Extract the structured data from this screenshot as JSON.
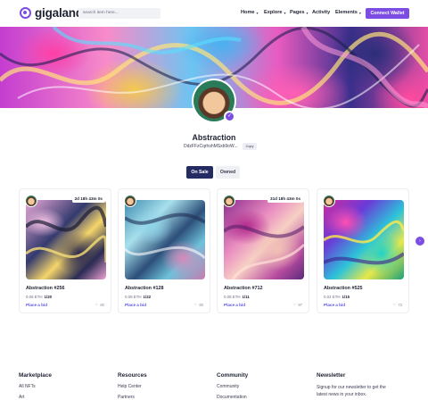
{
  "header": {
    "logo_text": "gigaland",
    "search_placeholder": "search item here...",
    "nav": [
      {
        "label": "Home",
        "caret": "▾"
      },
      {
        "label": "Explore",
        "caret": "▾"
      },
      {
        "label": "Pages",
        "caret": "▾"
      },
      {
        "label": "Activity",
        "caret": ""
      },
      {
        "label": "Elements",
        "caret": "▾"
      }
    ],
    "connect_label": "Connect Wallet"
  },
  "profile": {
    "name": "Abstraction",
    "wallet": "DdzFFzCqrhshMSxb9oW...",
    "copy_label": "Copy",
    "verified_glyph": "✓"
  },
  "tabs": {
    "on_sale": "On Sale",
    "owned": "Owned"
  },
  "cards": [
    {
      "title": "Abstraction #256",
      "price_label": "0.06 ETH",
      "count": "1/20",
      "bid": "Place a bid",
      "likes": "80",
      "countdown": "2d  18h  43m  0s"
    },
    {
      "title": "Abstraction #128",
      "price_label": "0.08 ETH",
      "count": "1/22",
      "bid": "Place a bid",
      "likes": "80",
      "countdown": ""
    },
    {
      "title": "Abstraction #712",
      "price_label": "0.05 ETH",
      "count": "1/11",
      "bid": "Place a bid",
      "likes": "97",
      "countdown": "31d  18h  43m  0s"
    },
    {
      "title": "Abstraction #525",
      "price_label": "0.02 ETH",
      "count": "1/15",
      "bid": "Place a bid",
      "likes": "73",
      "countdown": ""
    }
  ],
  "next_glyph": "›",
  "heart_glyph": "♡",
  "footer": {
    "marketplace": {
      "heading": "Marketplace",
      "links": [
        "All NFTs",
        "Art"
      ]
    },
    "resources": {
      "heading": "Resources",
      "links": [
        "Help Center",
        "Partners"
      ]
    },
    "community": {
      "heading": "Community",
      "links": [
        "Community",
        "Documentation"
      ]
    },
    "newsletter": {
      "heading": "Newsletter",
      "text_1": "Signup for our newsletter to get the",
      "text_2": "latest news in your inbox."
    }
  },
  "colors": {
    "accent": "#7b4de3",
    "navy": "#242b63",
    "bid_link": "#5a57e3"
  }
}
